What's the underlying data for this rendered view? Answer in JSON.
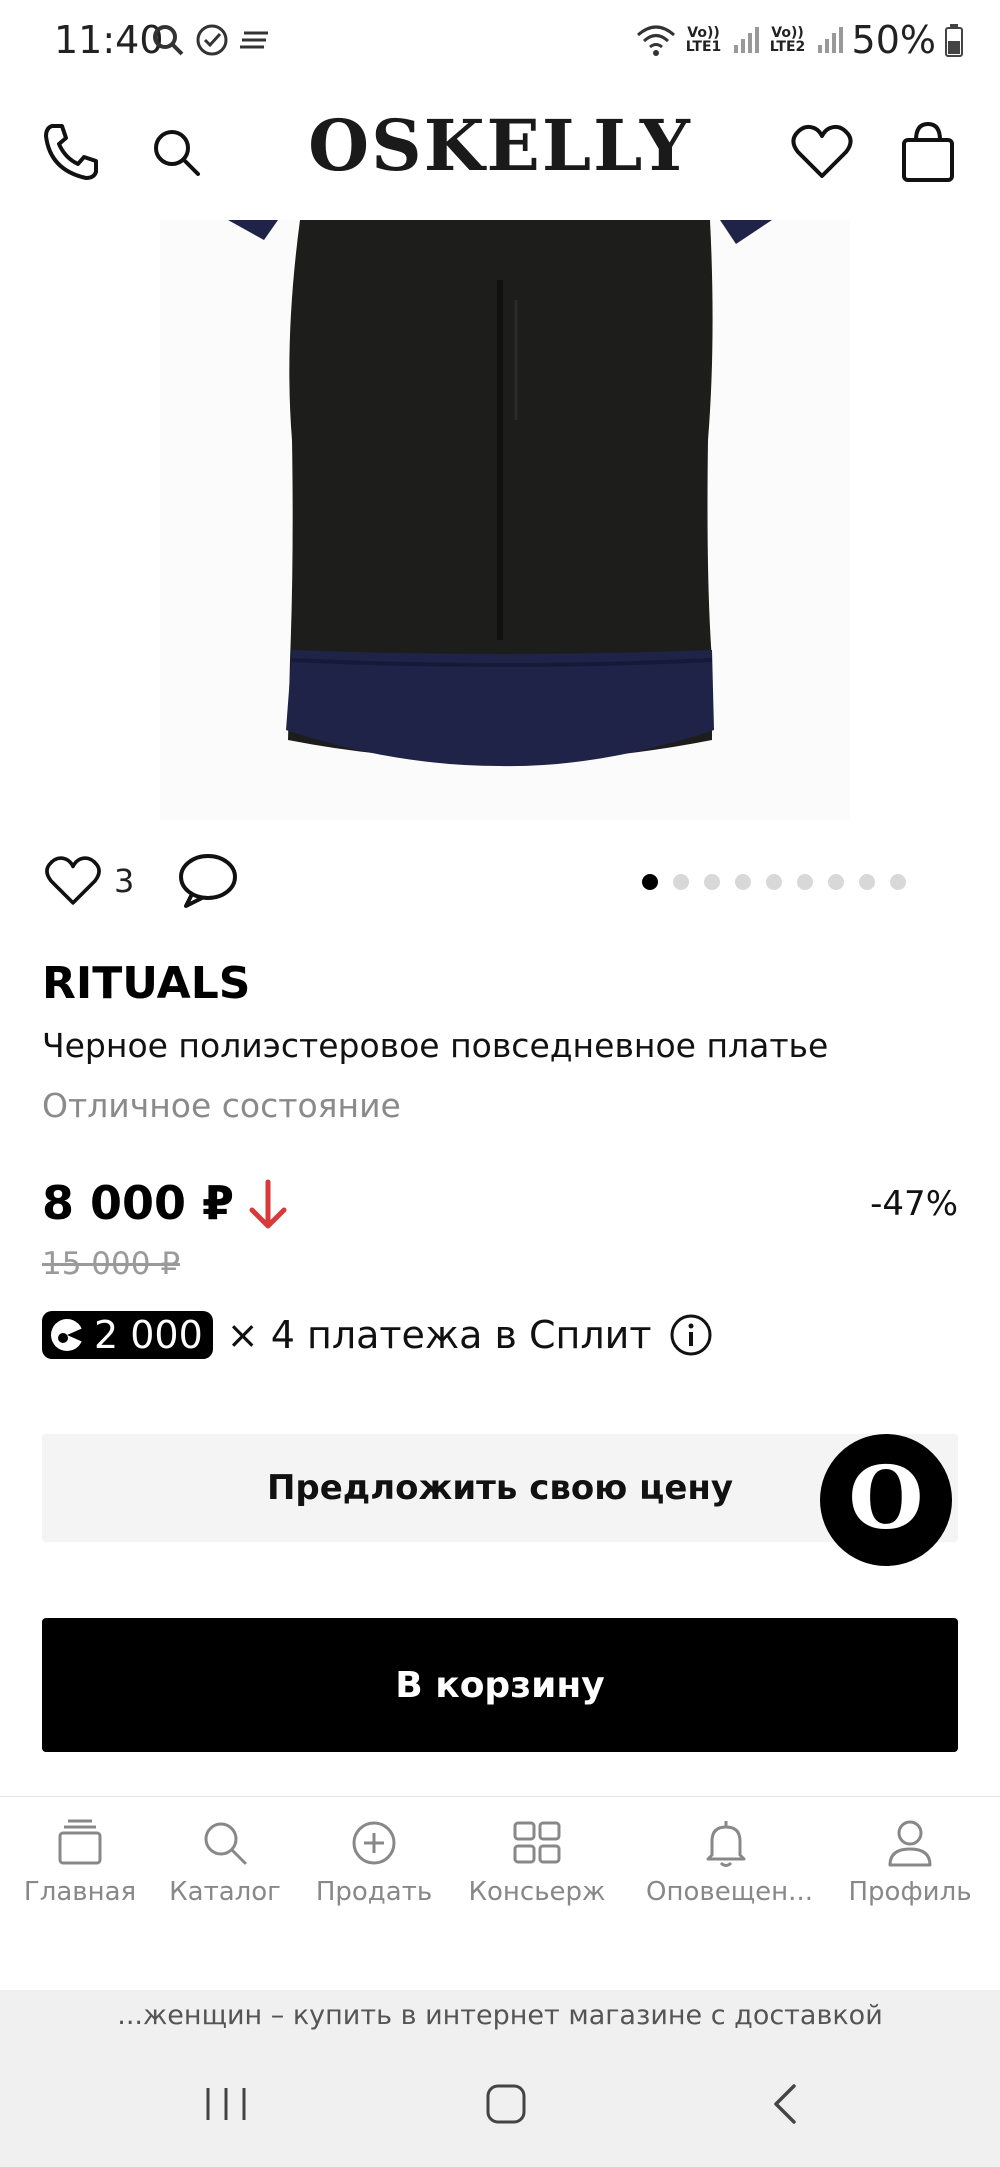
{
  "status_bar": {
    "time": "11:40",
    "battery_percent": "50%",
    "sim1_label": "Vo)) LTE1",
    "sim2_label": "Vo)) LTE2"
  },
  "header": {
    "logo": "OSKELLY",
    "icons": [
      "phone-icon",
      "search-icon",
      "heart-icon",
      "shopping-bag-icon"
    ]
  },
  "gallery": {
    "image_count": 9,
    "active_index": 0
  },
  "social": {
    "likes": "3",
    "icons": [
      "heart-icon",
      "comment-icon"
    ]
  },
  "product": {
    "brand": "RITUALS",
    "title": "Черное полиэстеровое повседневное платье",
    "condition": "Отличное состояние",
    "price": "8 000 ₽",
    "old_price": "15 000 ₽",
    "discount": "-47%"
  },
  "split": {
    "amount": "2 000",
    "text": "× 4 платежа в Сплит"
  },
  "buttons": {
    "offer": "Предложить свою цену",
    "cart": "В корзину",
    "fab": "O"
  },
  "bottom_nav": [
    {
      "label": "Главная",
      "icon": "home-cards-icon"
    },
    {
      "label": "Каталог",
      "icon": "search-icon"
    },
    {
      "label": "Продать",
      "icon": "plus-circle-icon"
    },
    {
      "label": "Консьерж",
      "icon": "grid-icon"
    },
    {
      "label": "Оповещен...",
      "icon": "bell-icon"
    },
    {
      "label": "Профиль",
      "icon": "profile-icon"
    }
  ],
  "browser": {
    "url_text": "...женщин – купить в интернет магазине с доставкой"
  },
  "colors": {
    "accent_red": "#d9393a",
    "navy": "#1f2347",
    "black": "#000000"
  }
}
